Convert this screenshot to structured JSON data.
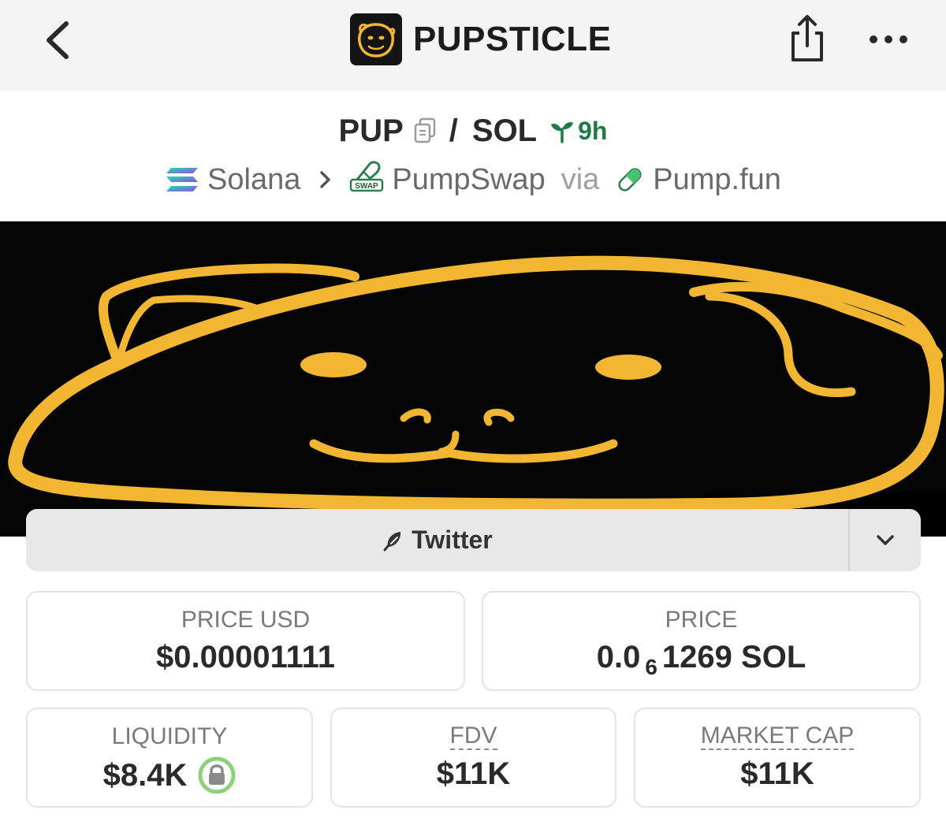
{
  "header": {
    "title": "PUPSTICLE",
    "back_icon": "chevron-left-icon",
    "share_icon": "share-icon",
    "more_icon": "more-dots-icon"
  },
  "pair": {
    "base": "PUP",
    "separator": "/",
    "quote": "SOL",
    "age": "9h",
    "age_color": "#1f7a45"
  },
  "route": {
    "chain": "Solana",
    "dex": "PumpSwap",
    "dex_badge": "SWAP",
    "via_label": "via",
    "launchpad": "Pump.fun"
  },
  "banner": {
    "accent": "#f2b632",
    "background": "#050505"
  },
  "links": {
    "primary_label": "Twitter"
  },
  "stats": {
    "price_usd": {
      "label": "PRICE USD",
      "value": "$0.00001111"
    },
    "price_native": {
      "label": "PRICE",
      "value_prefix": "0.0",
      "value_zeros": "6",
      "value_suffix": "1269 SOL"
    },
    "liquidity": {
      "label": "LIQUIDITY",
      "value": "$8.4K"
    },
    "fdv": {
      "label": "FDV",
      "value": "$11K"
    },
    "market_cap": {
      "label": "MARKET CAP",
      "value": "$11K"
    }
  }
}
